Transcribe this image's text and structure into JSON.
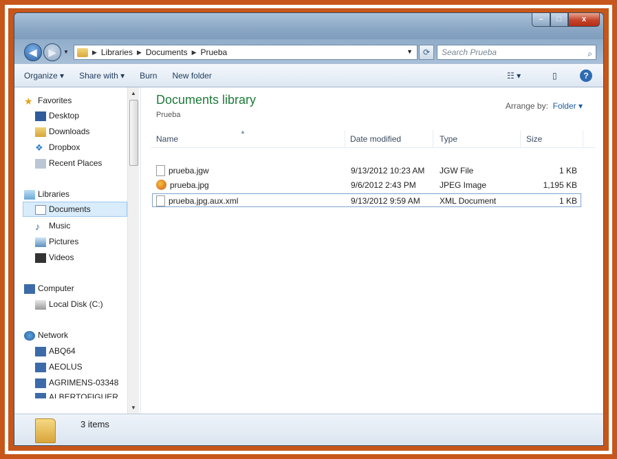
{
  "window": {
    "controls": {
      "minimize": "–",
      "maximize": "□",
      "close": "x"
    }
  },
  "address": {
    "crumbs": [
      "Libraries",
      "Documents",
      "Prueba"
    ],
    "search_placeholder": "Search Prueba"
  },
  "toolbar": {
    "organize": "Organize",
    "share_with": "Share with",
    "burn": "Burn",
    "new_folder": "New folder"
  },
  "sidebar": {
    "favorites": "Favorites",
    "desktop": "Desktop",
    "downloads": "Downloads",
    "dropbox": "Dropbox",
    "recent_places": "Recent Places",
    "libraries": "Libraries",
    "documents": "Documents",
    "music": "Music",
    "pictures": "Pictures",
    "videos": "Videos",
    "computer": "Computer",
    "local_disk": "Local Disk (C:)",
    "network": "Network",
    "abq64": "ABQ64",
    "aeolus": "AEOLUS",
    "agrimens": "AGRIMENS-03348",
    "albertofiguer": "ALBERTOFIGUER"
  },
  "library": {
    "title": "Documents library",
    "subtitle": "Prueba",
    "arrange_label": "Arrange by:",
    "arrange_value": "Folder"
  },
  "columns": {
    "name": "Name",
    "date": "Date modified",
    "type": "Type",
    "size": "Size"
  },
  "files": [
    {
      "name": "prueba.jgw",
      "date": "9/13/2012 10:23 AM",
      "type": "JGW File",
      "size": "1 KB"
    },
    {
      "name": "prueba.jpg",
      "date": "9/6/2012 2:43 PM",
      "type": "JPEG Image",
      "size": "1,195 KB"
    },
    {
      "name": "prueba.jpg.aux.xml",
      "date": "9/13/2012 9:59 AM",
      "type": "XML Document",
      "size": "1 KB"
    }
  ],
  "status": {
    "count": "3 items"
  },
  "colors": {
    "frame": "#c6561a",
    "library_title": "#1e7a3a",
    "selection": "#d9ecfb"
  }
}
